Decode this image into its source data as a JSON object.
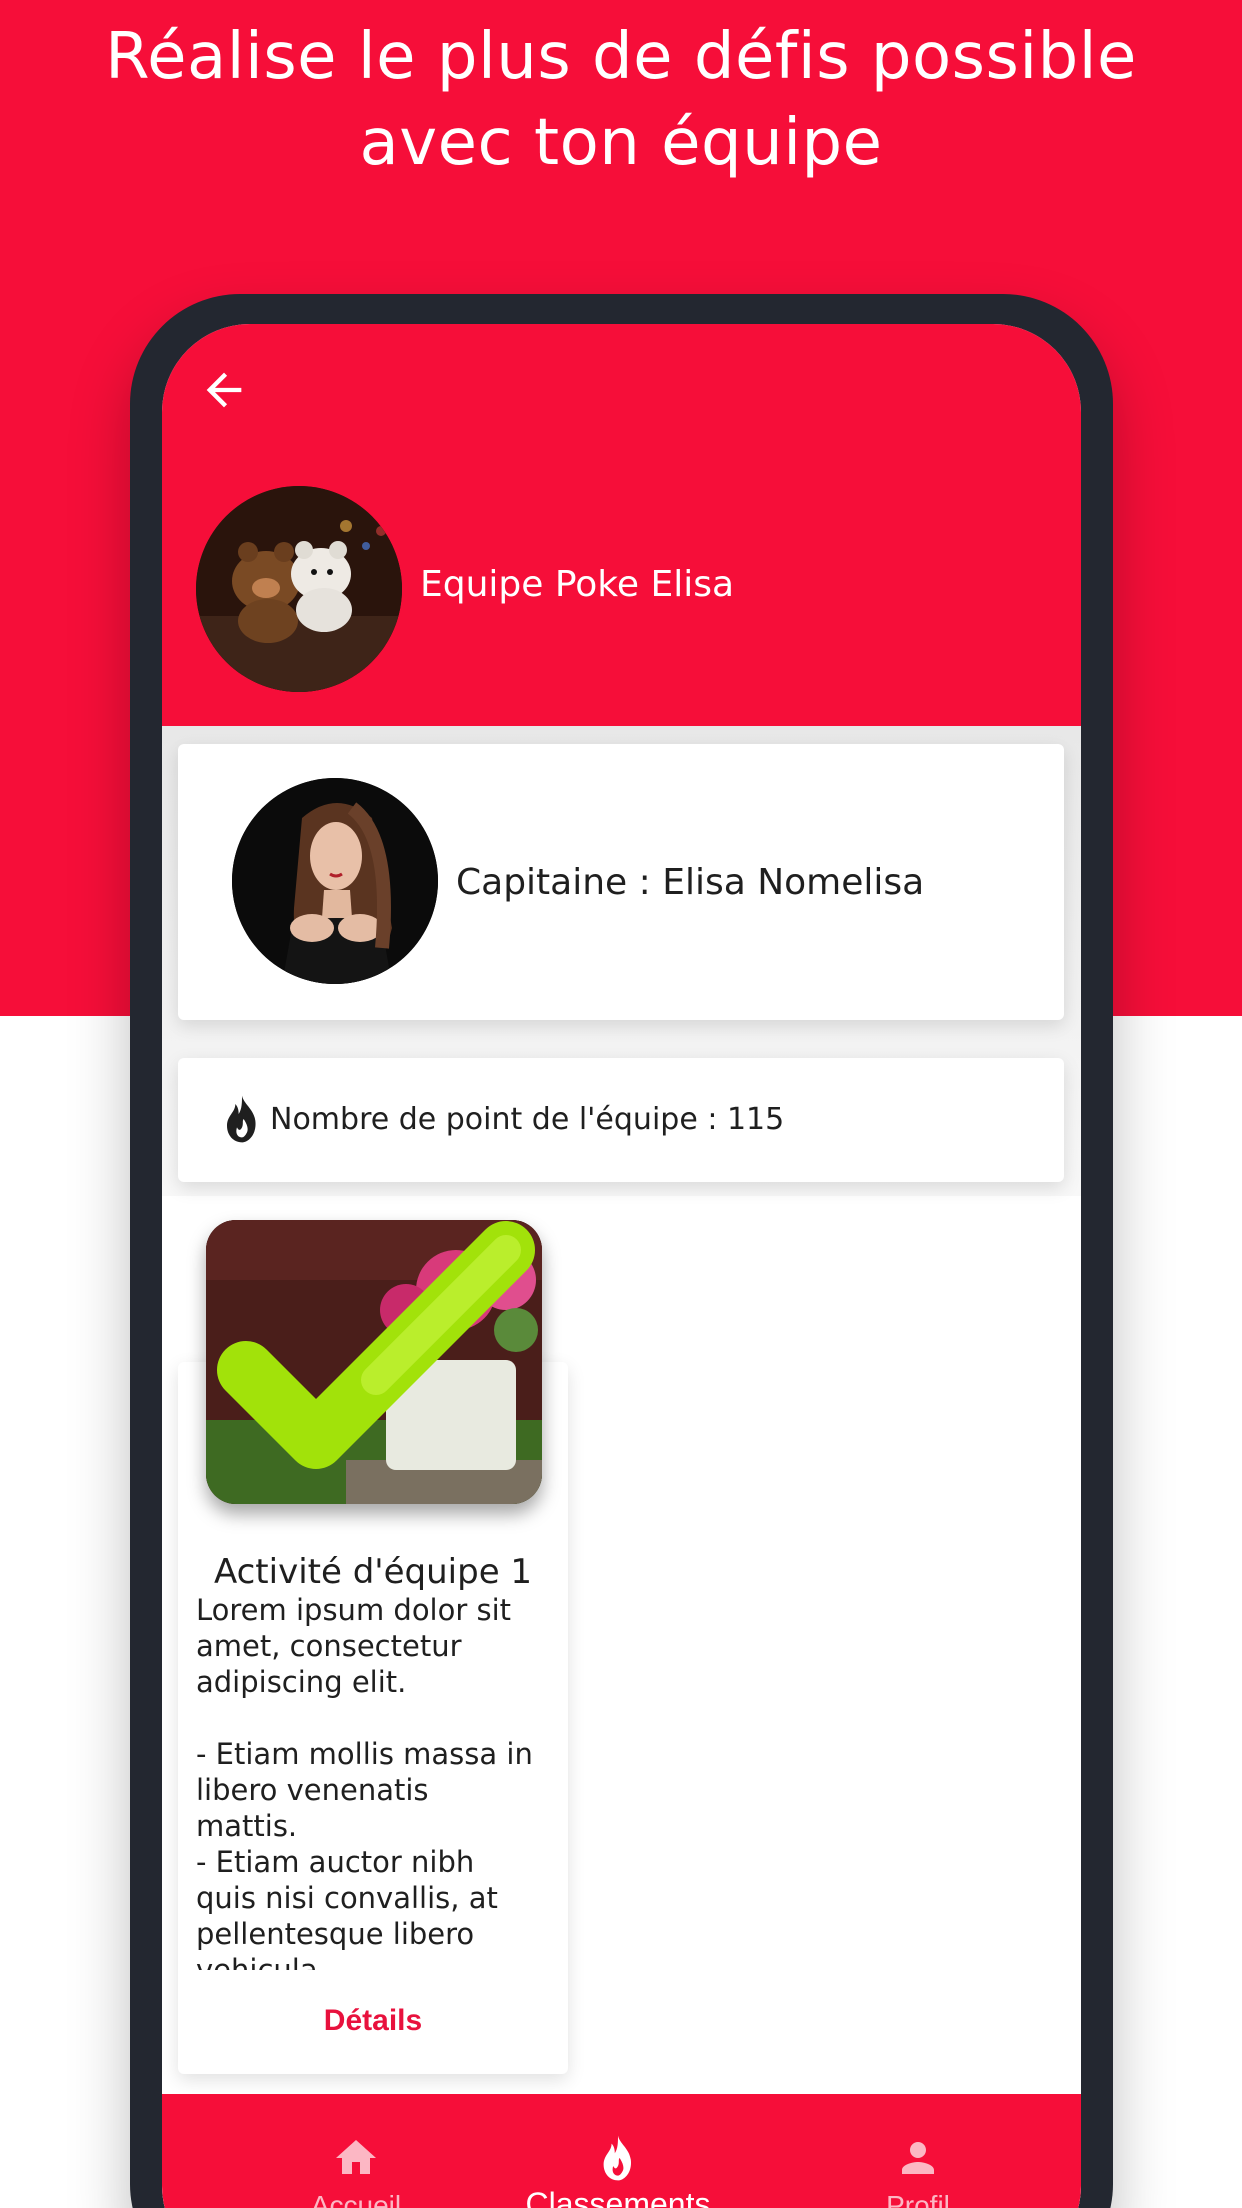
{
  "headline": {
    "line1": "Réalise le plus de défis possible",
    "line2": "avec ton équipe"
  },
  "colors": {
    "brand_red": "#f60e39",
    "phone_frame": "#232730",
    "details_red": "#e8113d"
  },
  "appbar": {
    "back_icon": "arrow-back-icon",
    "team_name": "Equipe Poke Elisa"
  },
  "captain": {
    "label": "Capitaine : Elisa Nomelisa"
  },
  "points": {
    "icon": "fire-icon",
    "label": "Nombre de point de l'équipe : 115"
  },
  "activity": {
    "title": "Activité d'équipe 1",
    "description": "Lorem ipsum dolor sit amet, consectetur adipiscing elit.\n\n - Etiam mollis massa in libero venenatis mattis.\n - Etiam auctor nibh quis nisi convallis, at pellentesque libero vehicula.\n - Proin nec nibh quis",
    "status_icon": "checkmark-icon",
    "details_label": "Détails"
  },
  "bottom_nav": {
    "items": [
      {
        "label": "Accueil",
        "icon": "home-icon",
        "active": false
      },
      {
        "label": "Classements",
        "icon": "fire-icon",
        "active": true
      },
      {
        "label": "Profil",
        "icon": "person-icon",
        "active": false
      }
    ]
  }
}
